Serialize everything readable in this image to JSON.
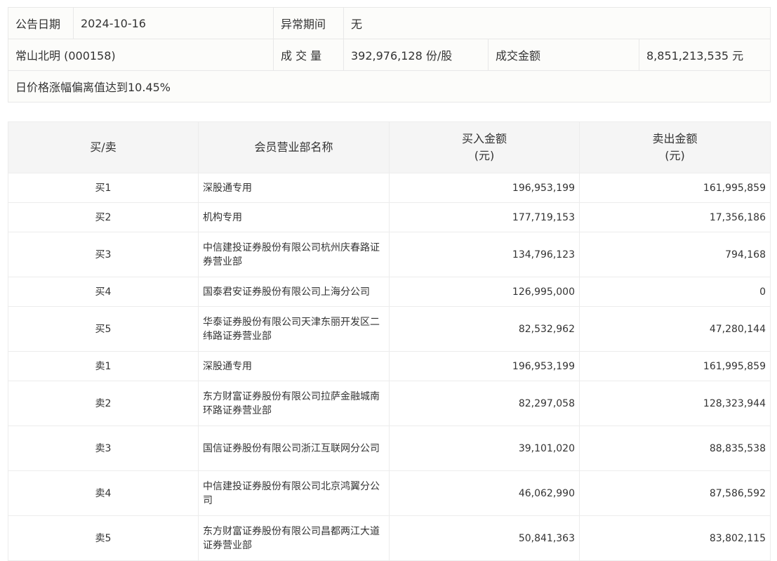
{
  "info": {
    "date_label": "公告日期",
    "date_value": "2024-10-16",
    "period_label": "异常期间",
    "period_value": "无",
    "stock": "常山北明 (000158)",
    "volume_label": "成 交 量",
    "volume_value": "392,976,128 份/股",
    "amount_label": "成交金额",
    "amount_value": "8,851,213,535 元",
    "reason": "日价格涨幅偏离值达到10.45%"
  },
  "table": {
    "headers": {
      "side": "买/卖",
      "name": "会员营业部名称",
      "buy": "买入金额",
      "buy_unit": "(元)",
      "sell": "卖出金额",
      "sell_unit": "(元)"
    },
    "rows": [
      {
        "side": "买1",
        "name": "深股通专用",
        "buy": "196,953,199",
        "sell": "161,995,859"
      },
      {
        "side": "买2",
        "name": "机构专用",
        "buy": "177,719,153",
        "sell": "17,356,186"
      },
      {
        "side": "买3",
        "name": "中信建投证券股份有限公司杭州庆春路证券营业部",
        "buy": "134,796,123",
        "sell": "794,168"
      },
      {
        "side": "买4",
        "name": "国泰君安证券股份有限公司上海分公司",
        "buy": "126,995,000",
        "sell": "0"
      },
      {
        "side": "买5",
        "name": "华泰证券股份有限公司天津东丽开发区二纬路证券营业部",
        "buy": "82,532,962",
        "sell": "47,280,144"
      },
      {
        "side": "卖1",
        "name": "深股通专用",
        "buy": "196,953,199",
        "sell": "161,995,859"
      },
      {
        "side": "卖2",
        "name": "东方财富证券股份有限公司拉萨金融城南环路证券营业部",
        "buy": "82,297,058",
        "sell": "128,323,944"
      },
      {
        "side": "卖3",
        "name": "国信证券股份有限公司浙江互联网分公司",
        "buy": "39,101,020",
        "sell": "88,835,538"
      },
      {
        "side": "卖4",
        "name": "中信建投证券股份有限公司北京鸿翼分公司",
        "buy": "46,062,990",
        "sell": "87,586,592"
      },
      {
        "side": "卖5",
        "name": "东方财富证券股份有限公司昌都两江大道证券营业部",
        "buy": "50,841,363",
        "sell": "83,802,115"
      }
    ]
  }
}
